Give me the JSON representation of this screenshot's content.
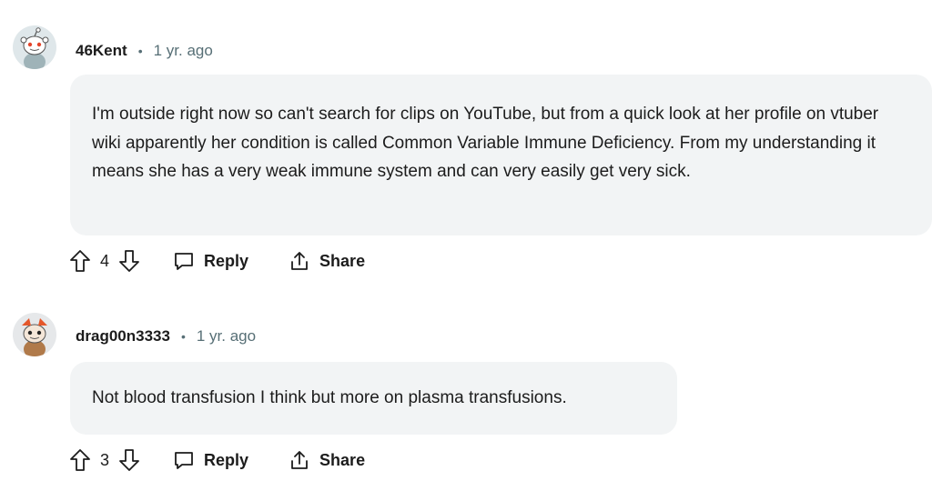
{
  "comments": [
    {
      "username": "46Kent",
      "separator": "•",
      "time": "1 yr. ago",
      "body": "I'm outside right now so can't search for clips on YouTube, but from a quick look at her profile on vtuber wiki apparently her condition is called Common Variable Immune Deficiency. From my understanding it means she has a very weak immune system and can very easily get very sick.",
      "votes": "4",
      "reply_label": "Reply",
      "share_label": "Share"
    },
    {
      "username": "drag00n3333",
      "separator": "•",
      "time": "1 yr. ago",
      "body": "Not blood transfusion I think but more on plasma transfusions.",
      "votes": "3",
      "reply_label": "Reply",
      "share_label": "Share"
    }
  ],
  "colors": {
    "bubble": "#f2f4f5",
    "meta_text": "#576f76",
    "text": "#1c1c1c"
  }
}
